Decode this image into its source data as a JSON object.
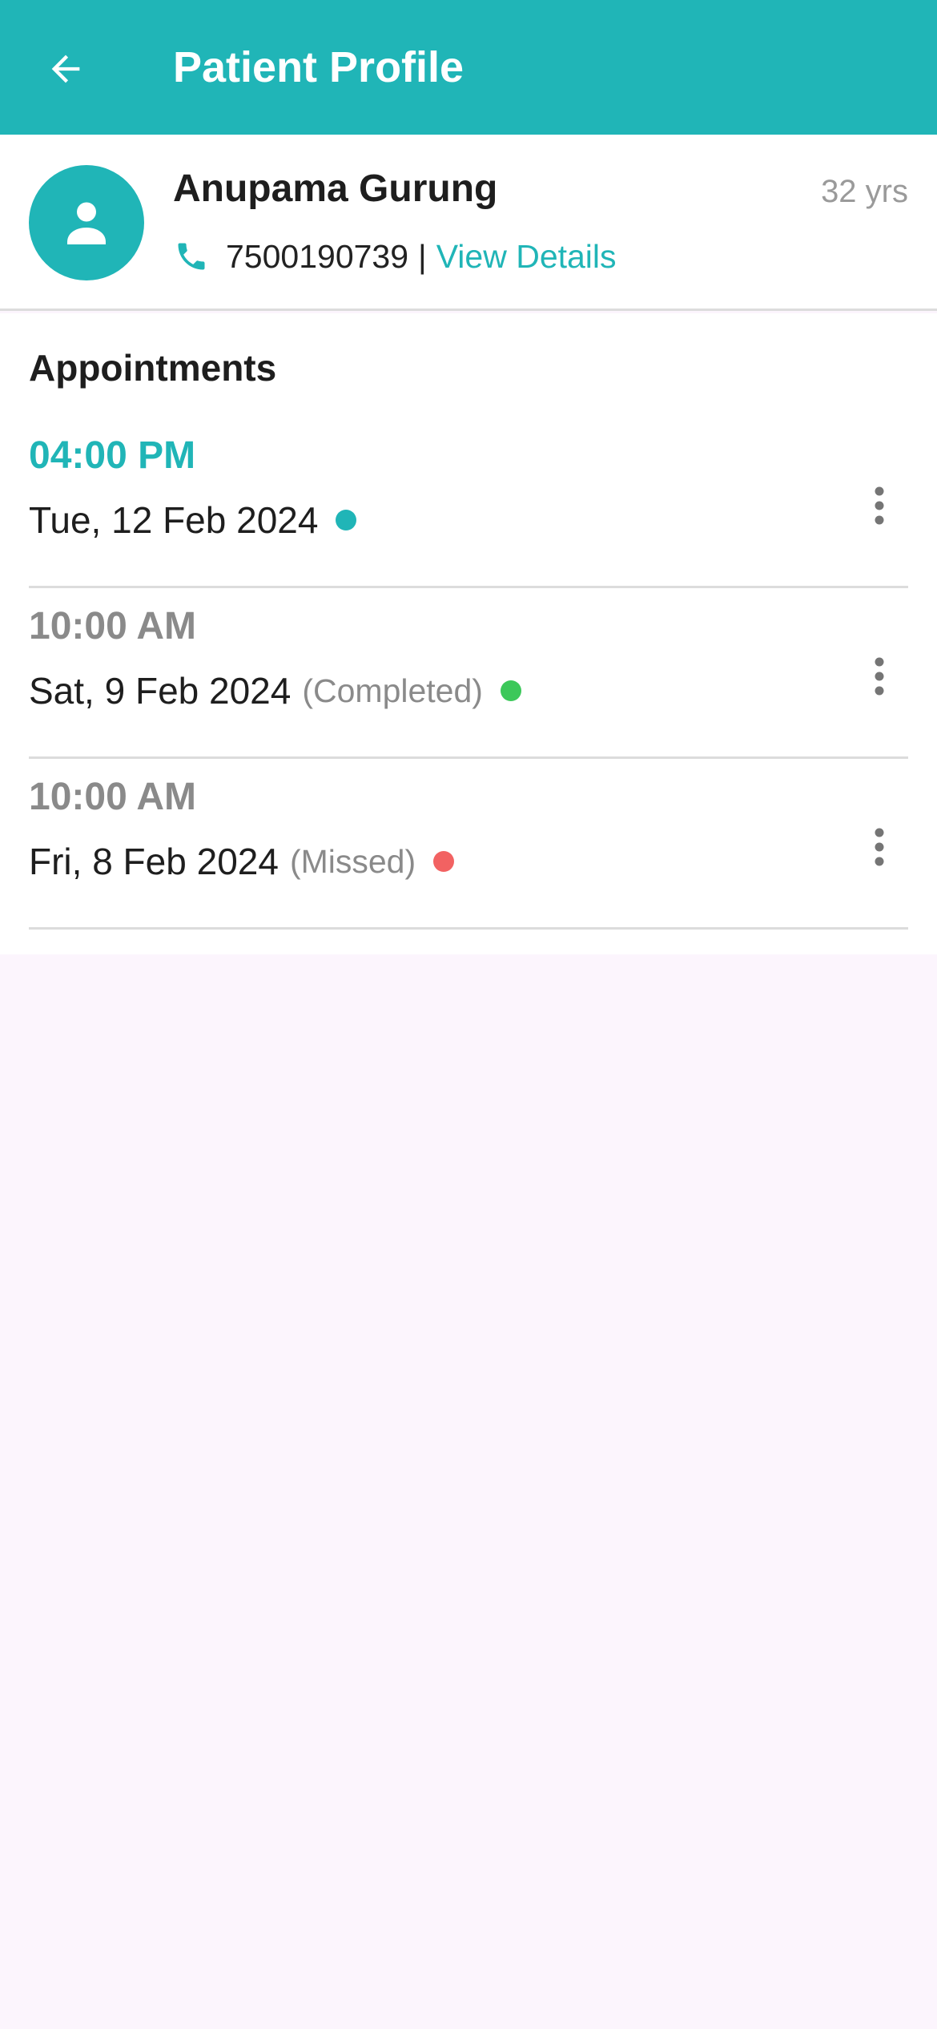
{
  "appbar": {
    "title": "Patient Profile",
    "back_icon": "arrow-back-icon"
  },
  "patient": {
    "name": "Anupama Gurung",
    "age": "32 yrs",
    "phone": "7500190739",
    "separator": "|",
    "view_details_label": "View Details",
    "avatar_icon": "person-icon",
    "phone_icon": "phone-icon"
  },
  "appointments": {
    "title": "Appointments",
    "items": [
      {
        "time": "04:00 PM",
        "date": "Tue, 12 Feb 2024",
        "status": "",
        "time_color": "#20b5b7",
        "dot_color": "#20b5b7"
      },
      {
        "time": "10:00 AM",
        "date": "Sat, 9 Feb 2024",
        "status": "(Completed)",
        "time_color": "#8a8a8a",
        "dot_color": "#3cc85a"
      },
      {
        "time": "10:00 AM",
        "date": "Fri, 8 Feb 2024",
        "status": "(Missed)",
        "time_color": "#8a8a8a",
        "dot_color": "#f26262"
      }
    ]
  },
  "colors": {
    "primary": "#20b5b7",
    "background": "#fcf5fd"
  }
}
